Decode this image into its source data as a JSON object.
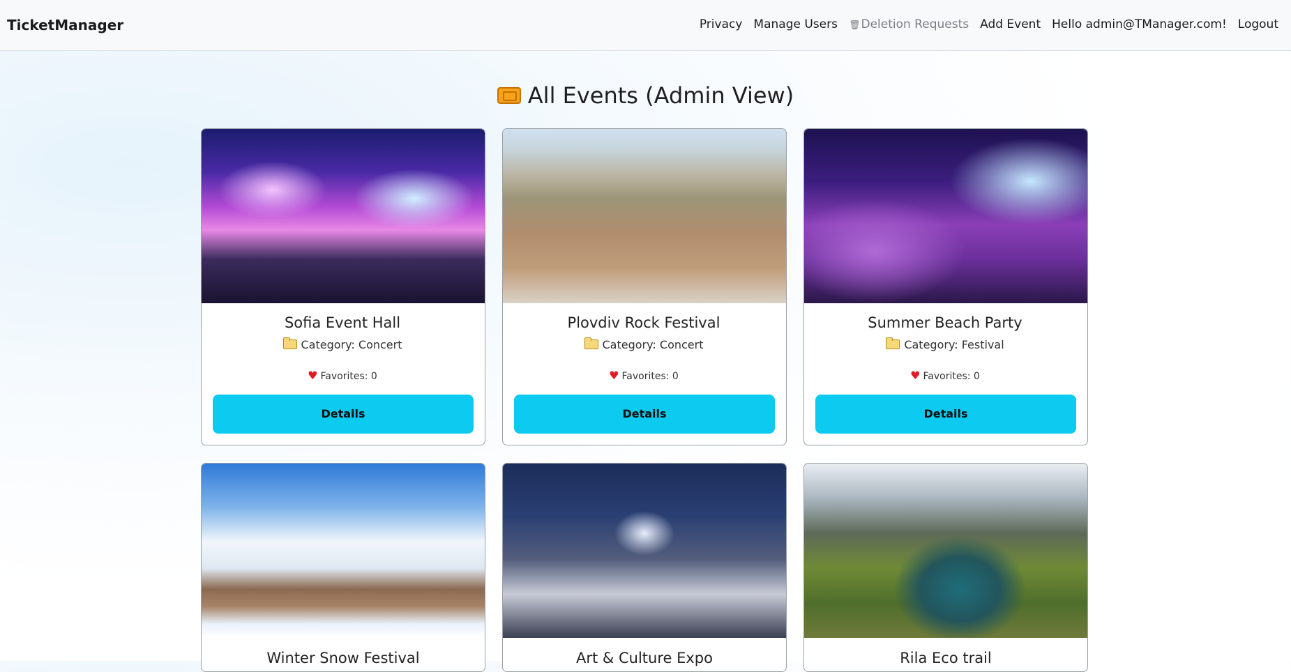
{
  "nav": {
    "brand": "TicketManager",
    "links": {
      "privacy": "Privacy",
      "manage_users": "Manage Users",
      "deletion_requests": "Deletion Requests",
      "add_event": "Add Event",
      "greeting": "Hello admin@TManager.com!",
      "logout": "Logout"
    },
    "trash_icon": "🗑"
  },
  "page": {
    "title": "All Events (Admin View)",
    "title_icon": "ticket-icon"
  },
  "events": [
    {
      "title": "Sofia Event Hall",
      "category": "Category: Concert",
      "favorites": "Favorites: 0",
      "button": "Details",
      "image": "event-hall-photo"
    },
    {
      "title": "Plovdiv Rock Festival",
      "category": "Category: Concert",
      "favorites": "Favorites: 0",
      "button": "Details",
      "image": "ancient-theatre-photo"
    },
    {
      "title": "Summer Beach Party",
      "category": "Category: Festival",
      "favorites": "Favorites: 0",
      "button": "Details",
      "image": "beach-party-photo"
    },
    {
      "title": "Winter Snow Festival",
      "image": "snow-resort-photo"
    },
    {
      "title": "Art & Culture Expo",
      "image": "fountains-palace-photo"
    },
    {
      "title": "Rila Eco trail",
      "image": "mountain-lake-photo"
    }
  ],
  "colors": {
    "accent_button": "#0dcaf0",
    "heart": "#e01b24",
    "navbar_bg": "#f8f9fa"
  }
}
